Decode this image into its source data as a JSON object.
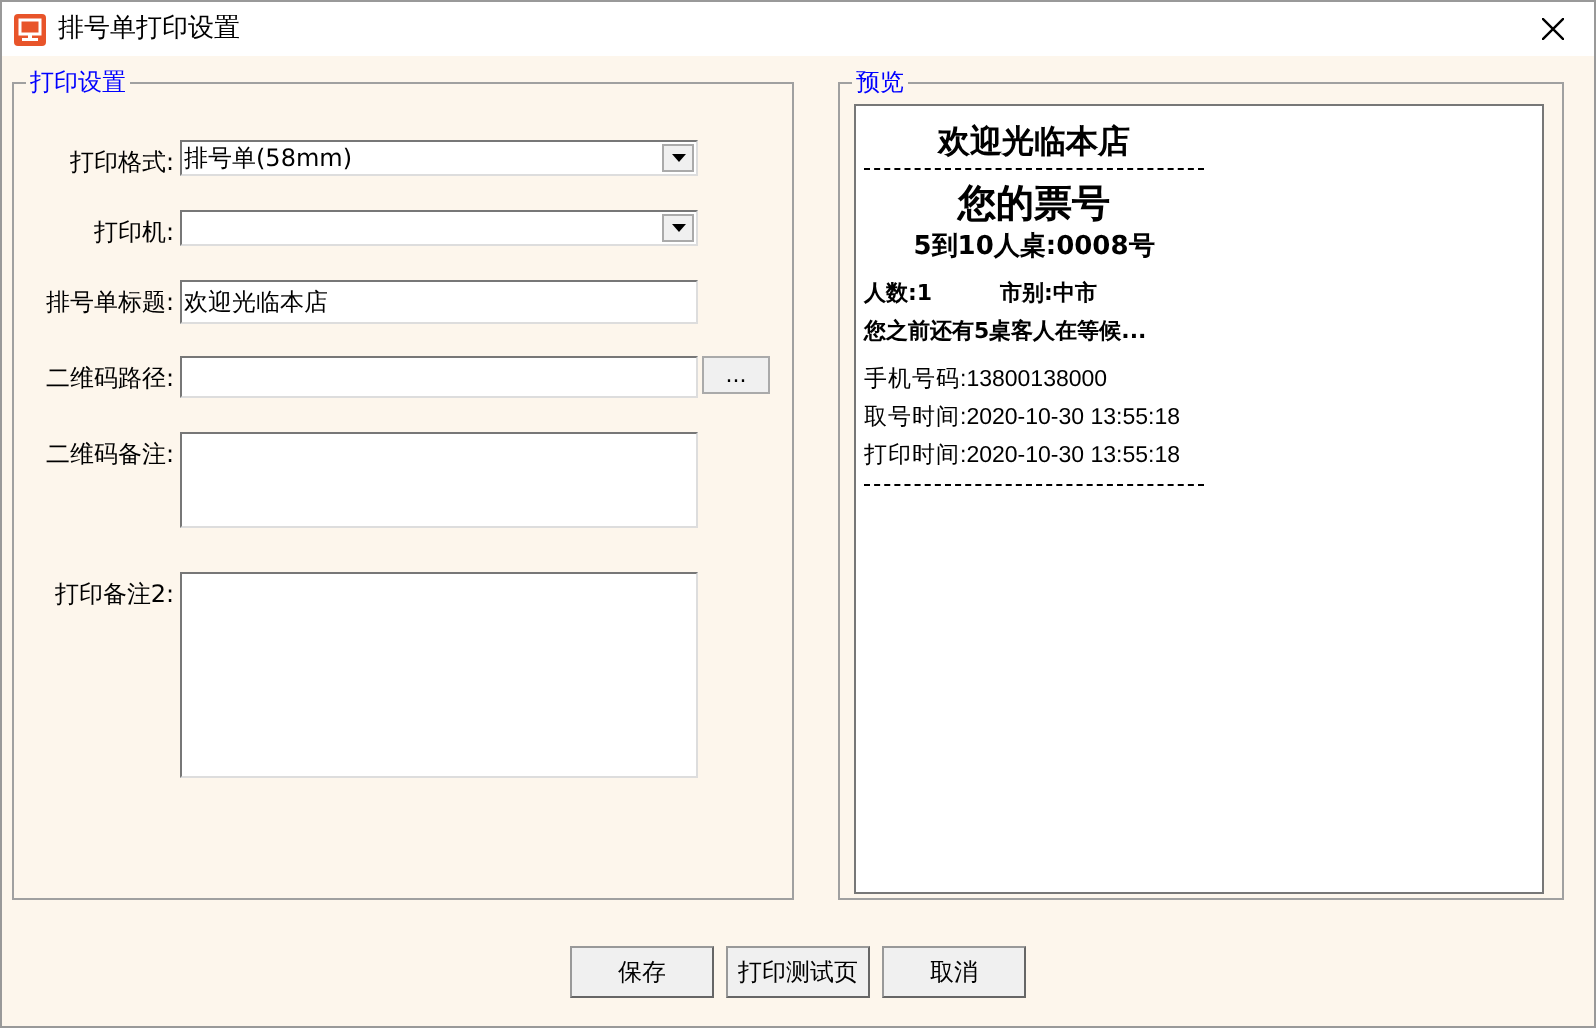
{
  "window": {
    "title": "排号单打印设置"
  },
  "settings": {
    "legend": "打印设置",
    "fields": [
      {
        "kind": "select",
        "label": "打印格式:",
        "value": "排号单(58mm)"
      },
      {
        "kind": "select",
        "label": "打印机:"
      },
      {
        "kind": "text",
        "label": "排号单标题:",
        "value": "欢迎光临本店"
      },
      {
        "kind": "browse",
        "label": "二维码路径:",
        "button": "..."
      },
      {
        "kind": "textarea",
        "label": "二维码备注:"
      },
      {
        "kind": "textarea",
        "label": "打印备注2:"
      }
    ]
  },
  "preview": {
    "legend": "预览",
    "lines": [
      {
        "kind": "title",
        "texts": [
          "欢迎光临本店"
        ]
      },
      {
        "kind": "dashed"
      },
      {
        "kind": "heading",
        "texts": [
          "您的票号"
        ]
      },
      {
        "kind": "ticket",
        "texts": [
          "5到10人桌:0008号"
        ]
      },
      {
        "kind": "pair",
        "texts": [
          "人数:1",
          "市别:中市"
        ]
      },
      {
        "kind": "bold",
        "texts": [
          "您之前还有5桌客人在等候..."
        ]
      },
      {
        "kind": "info",
        "texts": [
          "手机号码:13800138000"
        ]
      },
      {
        "kind": "info",
        "texts": [
          "取号时间:2020-10-30 13:55:18"
        ]
      },
      {
        "kind": "info",
        "texts": [
          "打印时间:2020-10-30 13:55:18"
        ]
      },
      {
        "kind": "dashed"
      }
    ]
  },
  "buttons": [
    "保存",
    "打印测试页",
    "取消"
  ]
}
